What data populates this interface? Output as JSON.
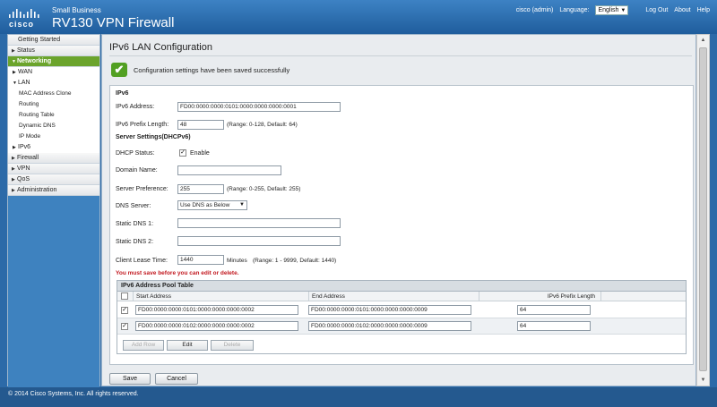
{
  "header": {
    "logo_text": "cisco",
    "brand_small": "Small Business",
    "product_name": "RV130 VPN Firewall",
    "user": "cisco (admin)",
    "language_label": "Language:",
    "language_value": "English",
    "logout": "Log Out",
    "about": "About",
    "help": "Help"
  },
  "sidebar": {
    "getting_started": "Getting Started",
    "status": "Status",
    "networking": "Networking",
    "wan": "WAN",
    "lan": "LAN",
    "lan_items": [
      "MAC Address Clone",
      "Routing",
      "Routing Table",
      "Dynamic DNS",
      "IP Mode"
    ],
    "ipv6": "IPv6",
    "firewall": "Firewall",
    "vpn": "VPN",
    "qos": "QoS",
    "administration": "Administration"
  },
  "page": {
    "title": "IPv6 LAN Configuration",
    "success_message": "Configuration settings have been saved successfully"
  },
  "ipv6": {
    "section_title": "IPv6",
    "address_label": "IPv6 Address:",
    "address_value": "FD00:0000:0000:0101:0000:0000:0000:0001",
    "prefix_label": "IPv6 Prefix Length:",
    "prefix_value": "48",
    "prefix_hint": "(Range: 0-128, Default: 64)"
  },
  "dhcp": {
    "section_title": "Server Settings(DHCPv6)",
    "status_label": "DHCP Status:",
    "status_checked": true,
    "enable_label": "Enable",
    "domain_label": "Domain Name:",
    "domain_value": "",
    "preference_label": "Server Preference:",
    "preference_value": "255",
    "preference_hint": "(Range: 0-255, Default: 255)",
    "dns_server_label": "DNS Server:",
    "dns_server_value": "Use DNS as Below",
    "static_dns1_label": "Static DNS 1:",
    "static_dns1_value": "",
    "static_dns2_label": "Static DNS 2:",
    "static_dns2_value": "",
    "lease_label": "Client Lease Time:",
    "lease_value": "1440",
    "lease_unit": "Minutes",
    "lease_hint": "(Range: 1 - 9999, Default: 1440)",
    "warning": "You must save before you can edit or delete."
  },
  "pool_table": {
    "title": "IPv6 Address Pool Table",
    "columns": [
      "Start Address",
      "End Address",
      "IPv6 Prefix Length"
    ],
    "rows": [
      {
        "checked": true,
        "start": "FD00:0000:0000:0101:0000:0000:0000:0002",
        "end": "FD00:0000:0000:0101:0000:0000:0000:0009",
        "prefix": "64"
      },
      {
        "checked": true,
        "start": "FD00:0000:0000:0102:0000:0000:0000:0002",
        "end": "FD00:0000:0000:0102:0000:0000:0000:0009",
        "prefix": "64"
      }
    ],
    "add_row": "Add Row",
    "edit": "Edit",
    "delete": "Delete"
  },
  "actions": {
    "save": "Save",
    "cancel": "Cancel"
  },
  "footer": {
    "copyright": "© 2014 Cisco Systems, Inc. All rights reserved."
  },
  "colors": {
    "header_blue": "#2c6aa8",
    "nav_active_green": "#6ba42c",
    "success_green": "#52a022",
    "warning_red": "#c2181f"
  }
}
